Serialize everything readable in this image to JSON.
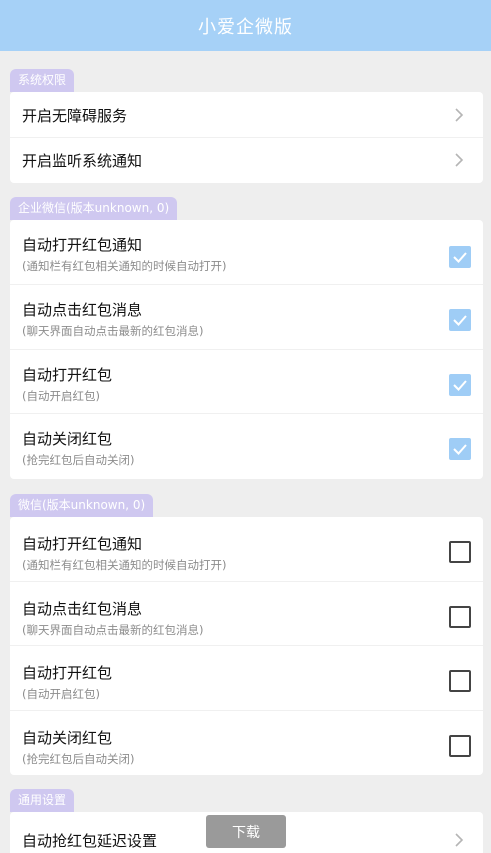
{
  "app": {
    "title": "小爱企微版"
  },
  "sections": {
    "permissions": {
      "tag": "系统权限",
      "items": [
        {
          "title": "开启无障碍服务"
        },
        {
          "title": "开启监听系统通知"
        }
      ]
    },
    "wework": {
      "tag": "企业微信(版本unknown, 0)",
      "items": [
        {
          "title": "自动打开红包通知",
          "subtitle": "(通知栏有红包相关通知的时候自动打开)",
          "checked": true
        },
        {
          "title": "自动点击红包消息",
          "subtitle": "(聊天界面自动点击最新的红包消息)",
          "checked": true
        },
        {
          "title": "自动打开红包",
          "subtitle": "(自动开启红包)",
          "checked": true
        },
        {
          "title": "自动关闭红包",
          "subtitle": "(抢完红包后自动关闭)",
          "checked": true
        }
      ]
    },
    "wechat": {
      "tag": "微信(版本unknown, 0)",
      "items": [
        {
          "title": "自动打开红包通知",
          "subtitle": "(通知栏有红包相关通知的时候自动打开)",
          "checked": false
        },
        {
          "title": "自动点击红包消息",
          "subtitle": "(聊天界面自动点击最新的红包消息)",
          "checked": false
        },
        {
          "title": "自动打开红包",
          "subtitle": "(自动开启红包)",
          "checked": false
        },
        {
          "title": "自动关闭红包",
          "subtitle": "(抢完红包后自动关闭)",
          "checked": false
        }
      ]
    },
    "general": {
      "tag": "通用设置",
      "items": [
        {
          "title": "自动抢红包延迟设置"
        }
      ]
    }
  },
  "toast": {
    "text": "下载"
  },
  "colors": {
    "titlebar": "#a6d1f7",
    "section_tag": "#cfc8f0",
    "checkbox_on": "#9fcdf6"
  },
  "icons": {
    "chevron": "chevron-right-icon",
    "check": "checkmark-icon"
  }
}
